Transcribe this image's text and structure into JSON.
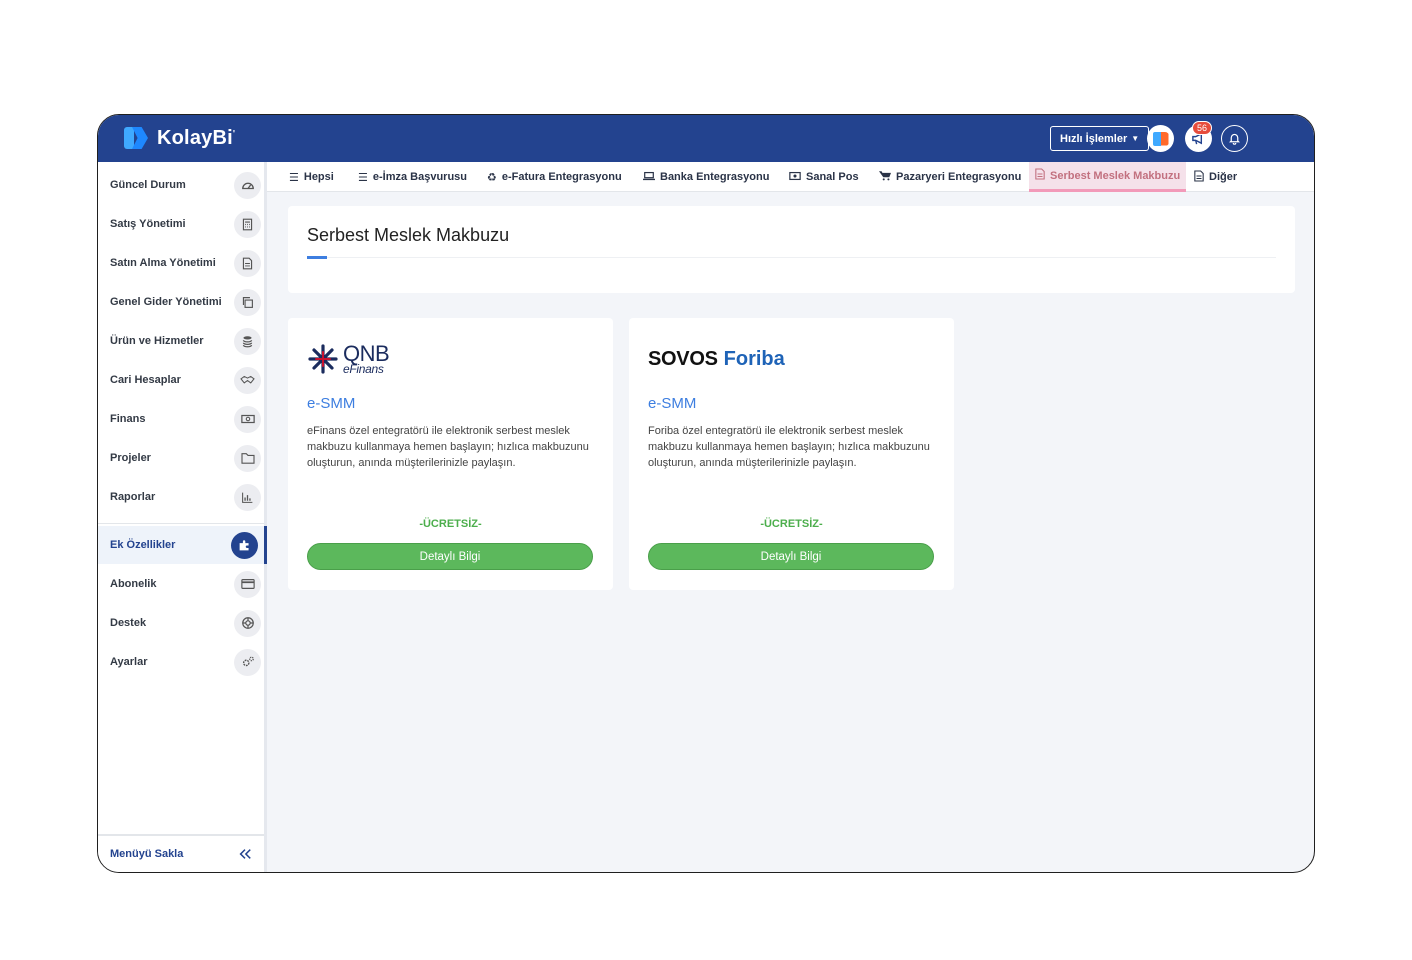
{
  "app": {
    "name": "KolayBi",
    "name_mark": "'"
  },
  "topbar": {
    "quick_actions_label": "Hızlı İşlemler",
    "notification_count": "56"
  },
  "sidebar": {
    "items": [
      {
        "label": "Güncel Durum",
        "icon": "dashboard-icon"
      },
      {
        "label": "Satış Yönetimi",
        "icon": "calculator-icon"
      },
      {
        "label": "Satın Alma Yönetimi",
        "icon": "document-icon"
      },
      {
        "label": "Genel Gider Yönetimi",
        "icon": "copy-icon"
      },
      {
        "label": "Ürün ve Hizmetler",
        "icon": "database-icon"
      },
      {
        "label": "Cari Hesaplar",
        "icon": "handshake-icon"
      },
      {
        "label": "Finans",
        "icon": "money-icon"
      },
      {
        "label": "Projeler",
        "icon": "folder-icon"
      },
      {
        "label": "Raporlar",
        "icon": "bar-chart-icon"
      },
      {
        "label": "Ek Özellikler",
        "icon": "puzzle-icon",
        "active": true
      },
      {
        "label": "Abonelik",
        "icon": "credit-card-icon"
      },
      {
        "label": "Destek",
        "icon": "lifebuoy-icon"
      },
      {
        "label": "Ayarlar",
        "icon": "gears-icon"
      }
    ],
    "footer_label": "Menüyü Sakla"
  },
  "tabs": [
    {
      "label": "Hepsi",
      "icon": "list-icon"
    },
    {
      "label": "e-İmza Başvurusu",
      "icon": "list-icon"
    },
    {
      "label": "e-Fatura Entegrasyonu",
      "icon": "recycle-icon"
    },
    {
      "label": "Banka Entegrasyonu",
      "icon": "laptop-icon"
    },
    {
      "label": "Sanal Pos",
      "icon": "money-icon"
    },
    {
      "label": "Pazaryeri Entegrasyonu",
      "icon": "cart-icon"
    },
    {
      "label": "Serbest Meslek Makbuzu",
      "icon": "file-icon",
      "active": true
    },
    {
      "label": "Diğer",
      "icon": "file-icon"
    }
  ],
  "page": {
    "title": "Serbest Meslek Makbuzu"
  },
  "cards": [
    {
      "logo_top": "QNB",
      "logo_bottom": "eFinans",
      "title": "e-SMM",
      "description": "eFinans özel entegratörü ile elektronik serbest meslek makbuzu kullanmaya hemen başlayın; hızlıca makbuzunu oluşturun, anında müşterilerinizle paylaşın.",
      "price_label": "-ÜCRETSİZ-",
      "button_label": "Detaylı Bilgi"
    },
    {
      "logo_left": "SOVOS",
      "logo_right": "Foriba",
      "title": "e-SMM",
      "description": "Foriba özel entegratörü ile elektronik serbest meslek makbuzu kullanmaya hemen başlayın; hızlıca makbuzunu oluşturun, anında müşterilerinizle paylaşın.",
      "price_label": "-ÜCRETSİZ-",
      "button_label": "Detaylı Bilgi"
    }
  ],
  "colors": {
    "topbar": "#23438f",
    "accent_blue": "#3d7ee0",
    "success_green": "#5cb85c",
    "active_tab_bg": "#f5e1ea",
    "badge_red": "#e74c3c"
  }
}
